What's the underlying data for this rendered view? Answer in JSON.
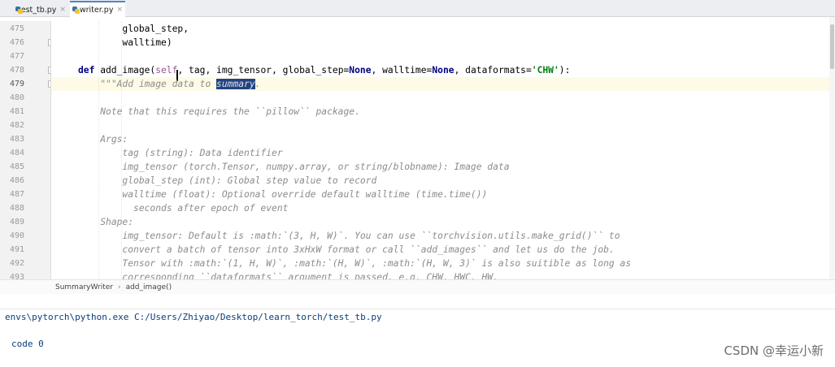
{
  "tabs": [
    {
      "label": "test_tb.py",
      "close": "×",
      "active": false
    },
    {
      "label": "writer.py",
      "close": "×",
      "active": true
    }
  ],
  "gutter": {
    "line_numbers": [
      "475",
      "476",
      "477",
      "478",
      "479",
      "480",
      "481",
      "482",
      "483",
      "484",
      "485",
      "486",
      "487",
      "488",
      "489",
      "490",
      "491",
      "492",
      "493"
    ]
  },
  "code": {
    "lines": [
      {
        "indent": "        ",
        "text": "global_step,"
      },
      {
        "indent": "        ",
        "text": "walltime)"
      },
      {
        "indent": "",
        "text": ""
      },
      {
        "kind": "def"
      },
      {
        "kind": "docstart"
      },
      {
        "indent": "",
        "text": ""
      },
      {
        "indent": "    ",
        "text": "Note that this requires the ``pillow`` package."
      },
      {
        "indent": "",
        "text": ""
      },
      {
        "indent": "    ",
        "text": "Args:"
      },
      {
        "indent": "        ",
        "text": "tag (string): Data identifier"
      },
      {
        "indent": "        ",
        "text": "img_tensor (torch.Tensor, numpy.array, or string/blobname): Image data"
      },
      {
        "indent": "        ",
        "text": "global_step (int): Global step value to record"
      },
      {
        "indent": "        ",
        "text": "walltime (float): Optional override default walltime (time.time())"
      },
      {
        "indent": "          ",
        "text": "seconds after epoch of event"
      },
      {
        "indent": "    ",
        "text": "Shape:"
      },
      {
        "indent": "        ",
        "text": "img_tensor: Default is :math:`(3, H, W)`. You can use ``torchvision.utils.make_grid()`` to"
      },
      {
        "indent": "        ",
        "text": "convert a batch of tensor into 3xHxW format or call ``add_images`` and let us do the job."
      },
      {
        "indent": "        ",
        "text": "Tensor with :math:`(1, H, W)`, :math:`(H, W)`, :math:`(H, W, 3)` is also suitible as long as"
      },
      {
        "indent": "        ",
        "text": "corresponding ``dataformats`` argument is passed, e.g. CHW, HWC, HW."
      }
    ],
    "def_line": {
      "kw_def": "def",
      "name": " add_image(",
      "self": "self",
      "params1": ", tag, img_tensor, global_step=",
      "none1": "None",
      "params2": ", walltime=",
      "none2": "None",
      "params3": ", dataformats=",
      "str": "'CHW'",
      "end": "):"
    },
    "doc_line": {
      "before": "\"\"\"Add image data to ",
      "selected": "summary",
      "after": "."
    }
  },
  "breadcrumb": {
    "items": [
      "SummaryWriter",
      "add_image()"
    ],
    "separator": "›"
  },
  "console": {
    "command": "envs\\pytorch\\python.exe C:/Users/Zhiyao/Desktop/learn_torch/test_tb.py",
    "output": "code 0"
  },
  "watermark": "CSDN @幸运小新",
  "colors": {
    "keyword": "#000080",
    "string": "#067d17",
    "docstring": "#8c8c8c",
    "self": "#94558d",
    "selection": "#214283",
    "console_text": "#0a3d7a"
  }
}
